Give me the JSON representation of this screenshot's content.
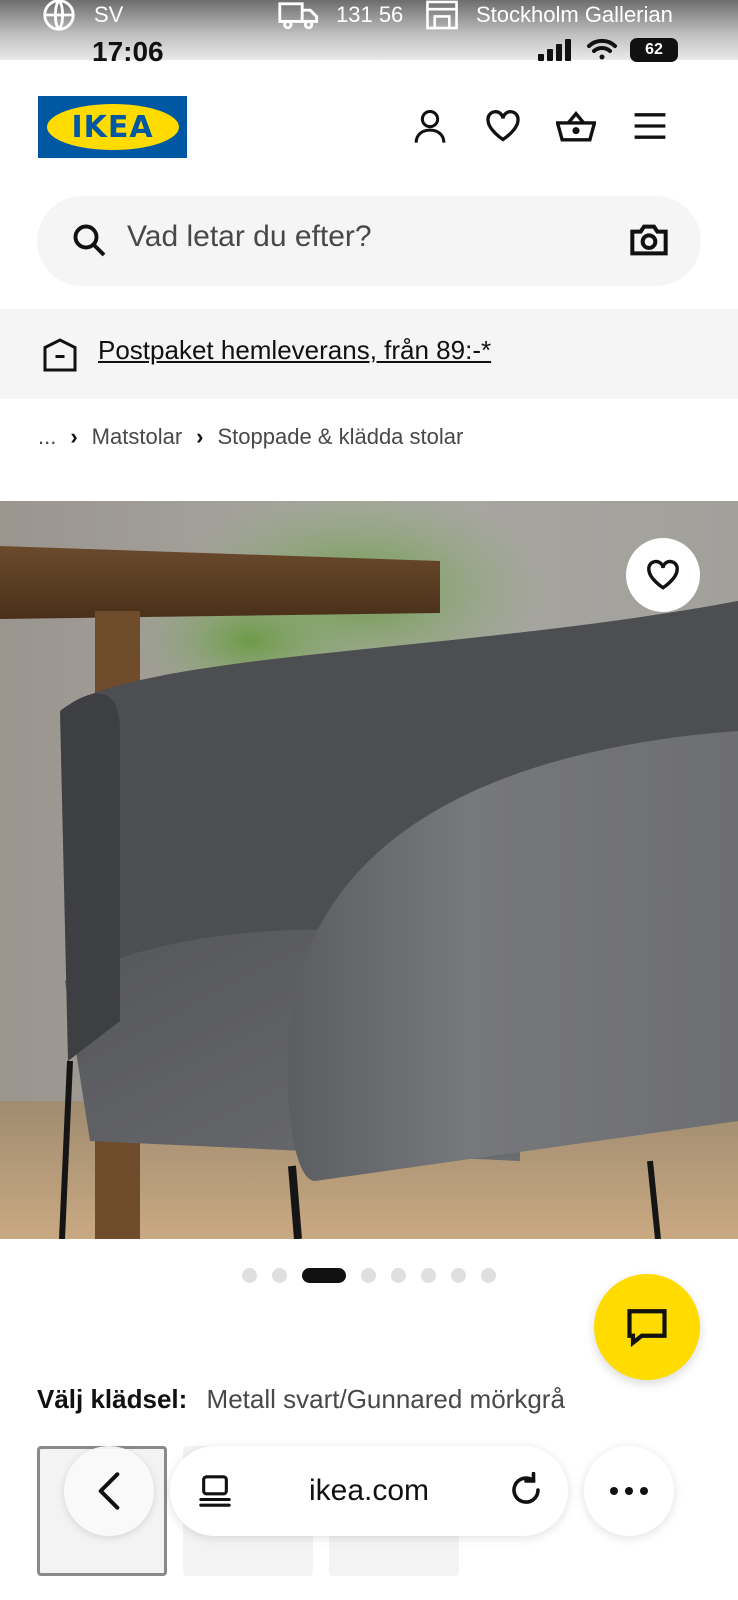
{
  "top_strip": {
    "language": "SV",
    "postal_code": "131 56",
    "store": "Stockholm Gallerian"
  },
  "status_bar": {
    "time": "17:06",
    "battery": "62"
  },
  "header": {
    "logo_text": "IKEA"
  },
  "search": {
    "placeholder": "Vad letar du efter?"
  },
  "promo": {
    "text": "Postpaket hemleverans, från 89:-*"
  },
  "breadcrumb": {
    "items": [
      "...",
      "Matstolar",
      "Stoppade & klädda stolar"
    ]
  },
  "carousel": {
    "total_images": 8,
    "active_index": 2
  },
  "option": {
    "label": "Välj klädsel:",
    "value": "Metall svart/Gunnared mörkgrå"
  },
  "browser": {
    "url": "ikea.com"
  },
  "colors": {
    "ikea_blue": "#0058a3",
    "ikea_yellow": "#ffdb00",
    "text_dark": "#111111",
    "text_muted": "#484848",
    "panel_gray": "#f5f5f5"
  },
  "icons": [
    "globe-icon",
    "truck-icon",
    "store-icon",
    "user-icon",
    "heart-icon",
    "basket-icon",
    "menu-icon",
    "search-icon",
    "camera-icon",
    "parcel-icon",
    "chat-icon",
    "back-icon",
    "reader-icon",
    "reload-icon",
    "more-icon"
  ]
}
